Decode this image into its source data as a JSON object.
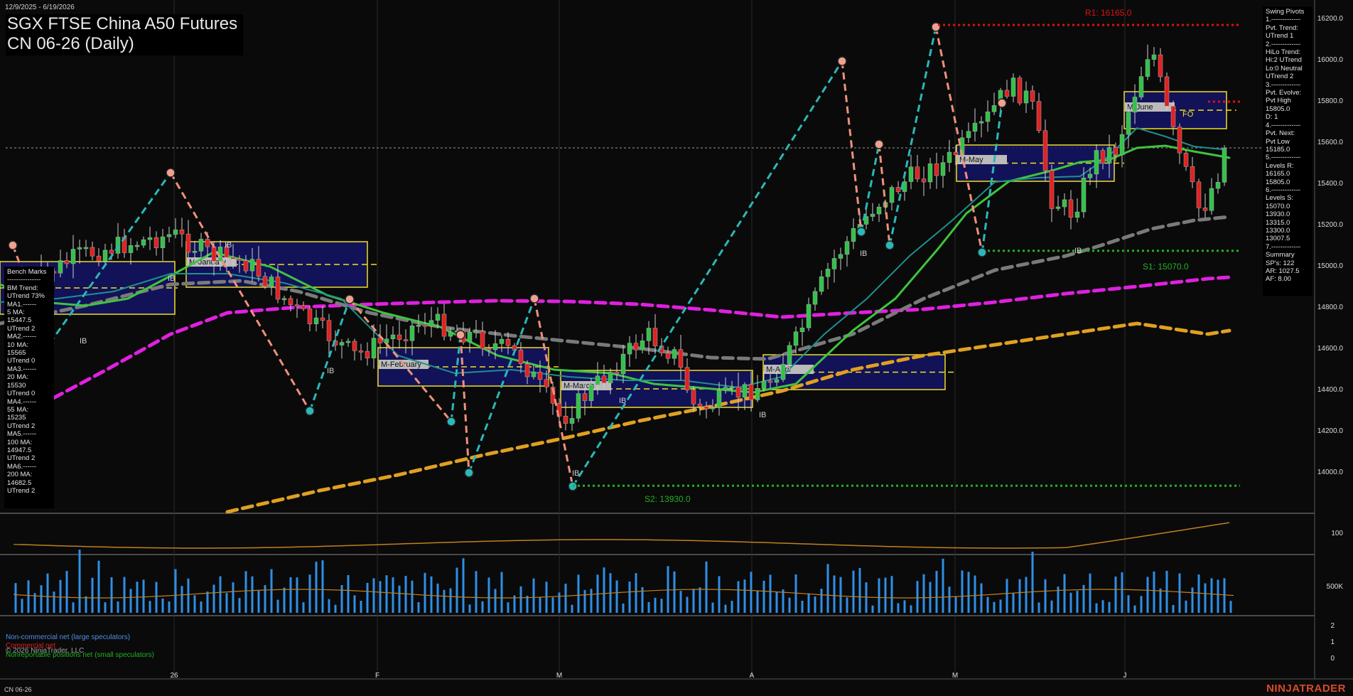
{
  "header": {
    "date_range": "12/9/2025 - 6/19/2026",
    "title_line1": "SGX FTSE China A50 Futures",
    "title_line2": "CN 06-26 (Daily)",
    "bottom_symbol": "CN 06-26",
    "logo": "NINJATRADER",
    "copyright": "© 2026 NinjaTrader, LLC"
  },
  "bench_marks": [
    "Bench Marks",
    "---------------",
    "BM Trend:",
    "UTrend 73%",
    "MA1.------",
    "5 MA:",
    "15447.5",
    "UTrend 2",
    "MA2.------",
    "10 MA:",
    "15565",
    "UTrend 0",
    "MA3.------",
    "20 MA:",
    "15530",
    "UTrend 0",
    "MA4.------",
    "55 MA:",
    "15235",
    "UTrend 2",
    "MA5.------",
    "100 MA:",
    "14947.5",
    "UTrend 2",
    "MA6.------",
    "200 MA:",
    "14682.5",
    "UTrend 2"
  ],
  "swing_pivots": [
    "Swing Pivots",
    "1.-------------",
    "Pvt. Trend:",
    "UTrend 1",
    "2.-------------",
    "HiLo Trend:",
    "Hi:2 UTrend",
    "Lo:0 Neutral",
    "UTrend 2",
    "3.-------------",
    "Pvt. Evolve:",
    "Pvt High",
    "15805.0",
    "D: 1",
    "4.-------------",
    "Pvt. Next:",
    "Pvt Low",
    "15185.0",
    "5.-------------",
    "Levels R:",
    "16165.0",
    "15805.0",
    "6.-------------",
    "Levels S:",
    "15070.0",
    "13930.0",
    "13315.0",
    "13300.0",
    "13007.5",
    "7.-------------",
    "Summary",
    "SP's: 122",
    "AR: 1027.5",
    "AF: 8.00"
  ],
  "levels": {
    "r1_label": "R1: 16165.0",
    "s1_label": "S1: 15070.0",
    "s2_label": "S2: 13930.0"
  },
  "month_boxes": [
    "M-January",
    "M-February",
    "M-March",
    "M-April",
    "M-May",
    "M-June"
  ],
  "fo_label": "FO",
  "ib_label": "IB",
  "legend": {
    "noncommercial": "Non-commercial net (large speculators)",
    "commercial": "Commercial net",
    "nonreportable": "Nonreportable positions net (small speculators)"
  },
  "colors": {
    "background": "#0a0a0a",
    "ma_green": "#3ec43e",
    "ma_gray": "#777777",
    "ma_magenta": "#e020e0",
    "ma_orange": "#e0a020",
    "swing_up": "#2ab8b8",
    "swing_down": "#f0907a",
    "resistance": "#e01010",
    "support": "#22b022",
    "box_yellow": "#f0e020",
    "box_fill": "#141466",
    "volume": "#2f8fe8",
    "osc": "#c08020"
  },
  "chart_data": {
    "type": "candlestick",
    "y_axis": {
      "ticks": [
        14000,
        14200,
        14400,
        14600,
        14800,
        15000,
        15200,
        15400,
        15600,
        15800,
        16000,
        16200
      ],
      "range": [
        13800,
        16300
      ]
    },
    "x_axis_labels": [
      "26",
      "F",
      "M",
      "A",
      "M",
      "J"
    ],
    "moving_averages": [
      {
        "label": "5 MA",
        "value": 15447.5
      },
      {
        "label": "10 MA",
        "value": 15565
      },
      {
        "label": "20 MA",
        "value": 15530
      },
      {
        "label": "55 MA",
        "value": 15235
      },
      {
        "label": "100 MA",
        "value": 14947.5
      },
      {
        "label": "200 MA",
        "value": 14682.5
      }
    ],
    "swing_pivots": [
      15100,
      15450,
      14300,
      14850,
      14250,
      14000,
      14850,
      13930,
      15980,
      15170,
      15600,
      15100,
      16165,
      15070,
      15805
    ],
    "levels": {
      "R1": 16165.0,
      "S1": 15070.0,
      "S2": 13930.0
    },
    "oscillator_pane": {
      "ticks": [
        100
      ]
    },
    "volume_pane": {
      "ticks": [
        "500K"
      ]
    },
    "cot_pane": {
      "ticks": [
        2,
        1,
        0
      ]
    }
  }
}
